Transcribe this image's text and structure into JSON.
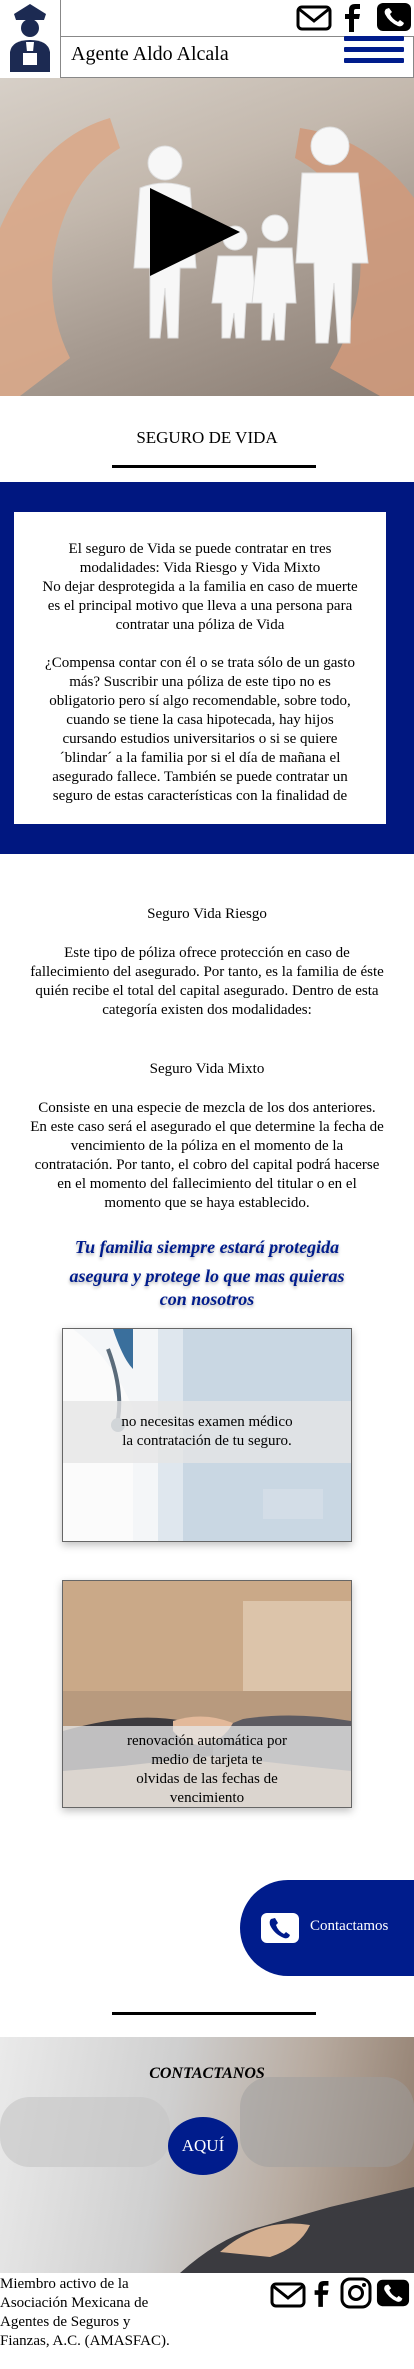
{
  "header": {
    "site_name": "Agente Aldo Alcala",
    "icons": [
      "mail-icon",
      "facebook-icon",
      "phone-icon",
      "hamburger-menu-icon"
    ]
  },
  "section": {
    "title": "SEGURO DE VIDA"
  },
  "intro_card": {
    "lines": [
      "El seguro de Vida se puede contratar en tres",
      "modalidades: Vida Riesgo y Vida Mixto",
      "No dejar desprotegida a la familia en caso de muerte",
      "es el principal motivo que lleva a una persona para",
      "contratar una póliza de Vida",
      "",
      "¿Compensa contar con él o se trata sólo de un gasto",
      "más? Suscribir una póliza de este tipo no es",
      "obligatorio pero sí algo recomendable, sobre todo,",
      "cuando se tiene la casa hipotecada, hay hijos",
      "cursando estudios universitarios o si se quiere",
      "´blindar´ a la familia por si el día de mañana el",
      "asegurado fallece. También se puede contratar un",
      "seguro de estas características con la finalidad de"
    ]
  },
  "riesgo": {
    "title": "Seguro Vida Riesgo",
    "lines": [
      "Este tipo de póliza ofrece protección en caso de",
      "fallecimiento del asegurado. Por tanto, es la familia de éste",
      "quién recibe el total del capital asegurado. Dentro de esta",
      "categoría existen dos modalidades:"
    ]
  },
  "mixto": {
    "title": "Seguro Vida Mixto",
    "lines": [
      "Consiste en una especie de mezcla de los dos anteriores.",
      "En este caso será el asegurado el que determine la fecha de",
      "vencimiento de la póliza en el momento de la",
      "contratación. Por tanto, el cobro del capital podrá hacerse",
      "en el momento del fallecimiento del titular o en el",
      "momento que se haya establecido."
    ]
  },
  "tagline": {
    "lines": [
      "Tu familia siempre estará protegida",
      "asegura y protege lo que mas quieras",
      "con nosotros"
    ]
  },
  "feature_cards": [
    {
      "lines": [
        "no necesitas examen médico",
        "la contratación de tu seguro."
      ]
    },
    {
      "lines": [
        "renovación automática por",
        "medio de tarjeta te",
        "olvidas de las fechas de",
        "vencimiento"
      ]
    }
  ],
  "contact_pill": {
    "label": "Contactamos"
  },
  "contact_section": {
    "title": "CONTACTANOS",
    "button": "AQUÍ"
  },
  "footer": {
    "lines": [
      "Miembro activo de la",
      "Asociación Mexicana de",
      "Agentes de Seguros y",
      "Fianzas, A.C. (AMASFAC)."
    ],
    "icons": [
      "mail-icon",
      "facebook-icon",
      "instagram-icon",
      "phone-icon"
    ]
  },
  "colors": {
    "brand_blue": "#001c8c",
    "box_blue": "#001780"
  }
}
